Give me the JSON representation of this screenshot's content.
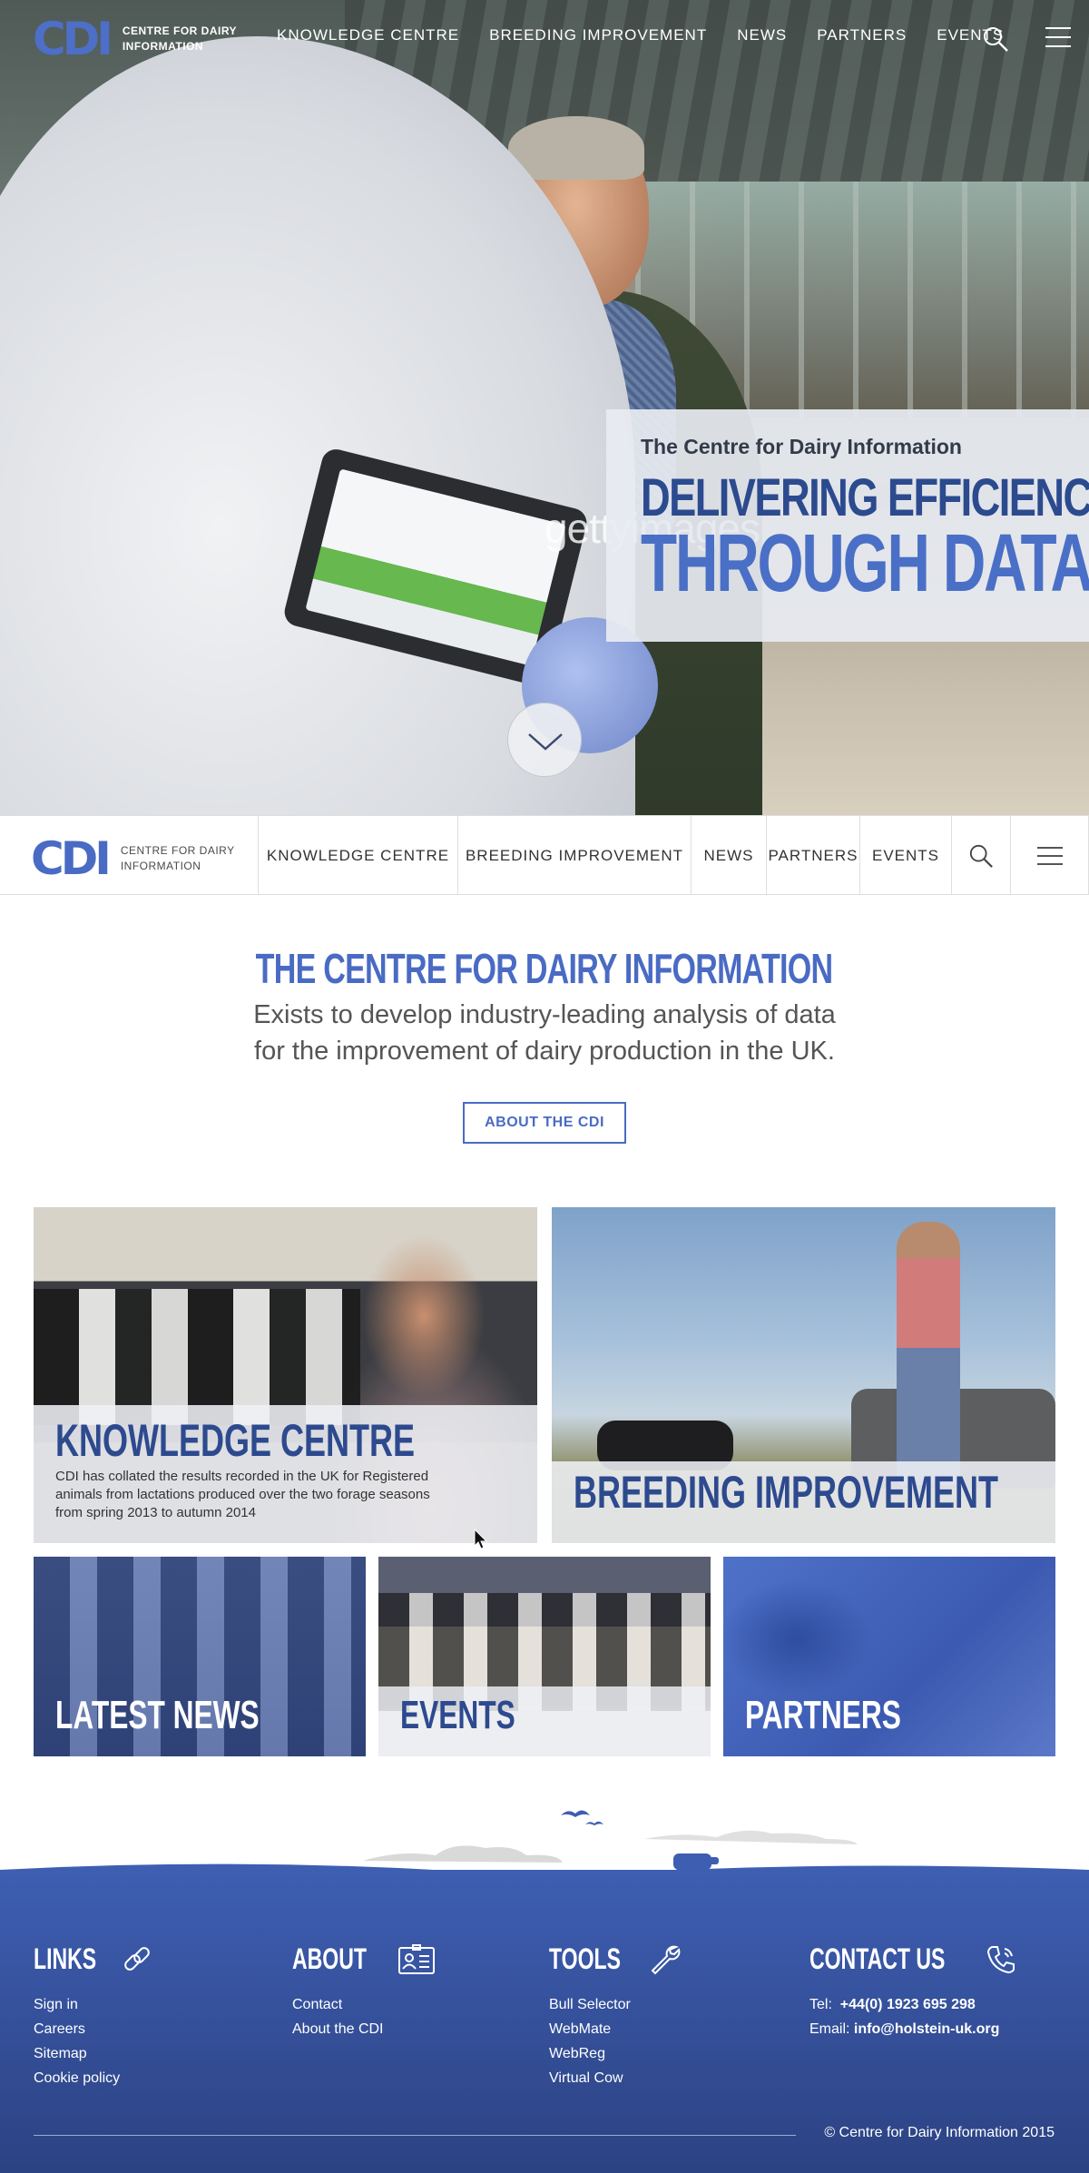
{
  "nav": {
    "logo_mark": "CDI",
    "logo_text_1": "Centre for Dairy",
    "logo_text_2": "Information",
    "items": [
      {
        "label": "Knowledge Centre"
      },
      {
        "label": "Breeding Improvement"
      },
      {
        "label": "News"
      },
      {
        "label": "Partners"
      },
      {
        "label": "Events"
      }
    ],
    "search_icon": "search-icon",
    "menu_icon": "hamburger-menu-icon"
  },
  "hero": {
    "kicker": "The Centre for Dairy Information",
    "headline_1": "Delivering Efficiency",
    "headline_2": "Through Data",
    "watermark": "gettyimages",
    "scroll_icon": "chevron-down-icon"
  },
  "intro": {
    "title": "The Centre for Dairy Information",
    "line_1": "Exists to develop industry-leading analysis of data",
    "line_2": "for the improvement of dairy production in the UK.",
    "button": "About the CDI"
  },
  "tiles": {
    "knowledge": {
      "title": "Knowledge Centre",
      "desc": "CDI has collated the results recorded in the UK for Registered animals from lactations produced over the two forage seasons from spring 2013 to autumn 2014"
    },
    "breeding": {
      "title": "Breeding Improvement"
    },
    "news": {
      "title": "Latest News"
    },
    "events": {
      "title": "Events"
    },
    "partners": {
      "title": "Partners"
    }
  },
  "footer": {
    "links": {
      "title": "Links",
      "icon": "link-icon",
      "items": [
        "Sign in",
        "Careers",
        "Sitemap",
        "Cookie policy"
      ]
    },
    "about": {
      "title": "About",
      "icon": "id-card-icon",
      "items": [
        "Contact",
        "About the CDI"
      ]
    },
    "tools": {
      "title": "Tools",
      "icon": "wrench-icon",
      "items": [
        "Bull Selector",
        "WebMate",
        "WebReg",
        "Virtual Cow"
      ]
    },
    "contact": {
      "title": "Contact Us",
      "icon": "phone-icon",
      "tel_label": "Tel:",
      "tel": "+44(0) 1923 695 298",
      "email_label": "Email:",
      "email": "info@holstein-uk.org"
    },
    "copyright": "© Centre for Dairy Information 2015"
  },
  "colors": {
    "brand_blue": "#4a6bc4",
    "dark_blue": "#2d4a8f",
    "footer_blue": "#3e5eb2"
  }
}
